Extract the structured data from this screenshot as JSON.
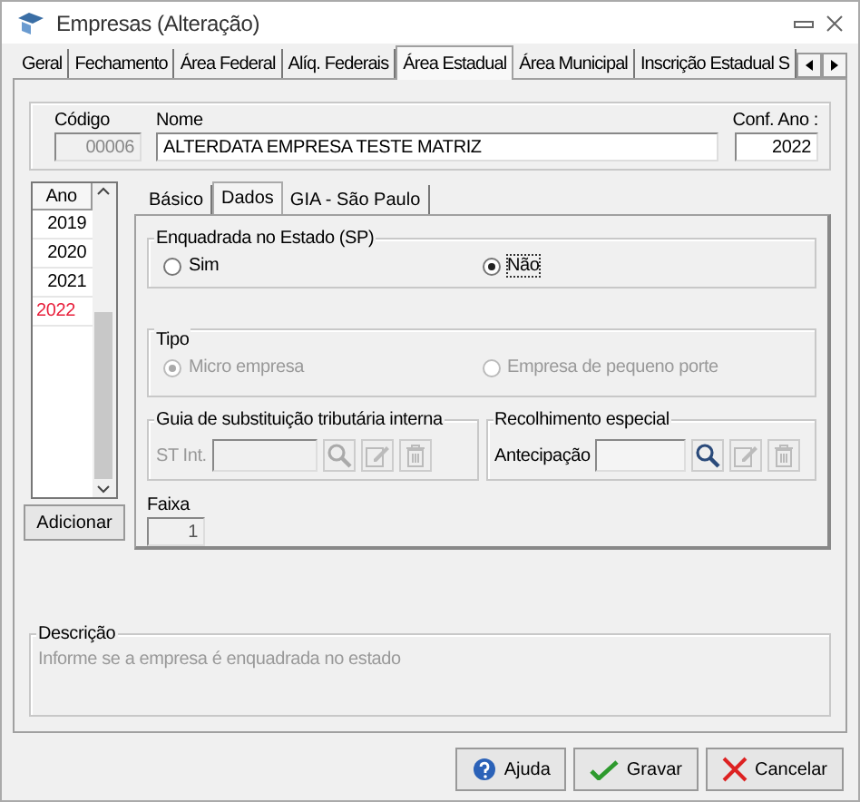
{
  "window": {
    "title": "Empresas (Alteração)"
  },
  "tabs": [
    {
      "label": "Geral",
      "selected": false
    },
    {
      "label": "Fechamento",
      "selected": false
    },
    {
      "label": "Área Federal",
      "selected": false
    },
    {
      "label": "Alíq. Federais",
      "selected": false
    },
    {
      "label": "Área Estadual",
      "selected": true
    },
    {
      "label": "Área Municipal",
      "selected": false
    },
    {
      "label": "Inscrição Estadual S",
      "selected": false
    }
  ],
  "header": {
    "codigo_label": "Código",
    "codigo": "00006",
    "nome_label": "Nome",
    "nome": "ALTERDATA EMPRESA TESTE MATRIZ",
    "ano_label": "Conf. Ano :",
    "ano": "2022"
  },
  "years": {
    "heading": "Ano",
    "items": [
      {
        "label": "2019",
        "selected": false
      },
      {
        "label": "2020",
        "selected": false
      },
      {
        "label": "2021",
        "selected": false
      },
      {
        "label": "2022",
        "selected": true
      }
    ],
    "add_button": "Adicionar"
  },
  "subtabs": [
    {
      "label": "Básico",
      "selected": false
    },
    {
      "label": "Dados",
      "selected": true
    },
    {
      "label": "GIA - São Paulo",
      "selected": false
    }
  ],
  "enquadrada": {
    "title": "Enquadrada no Estado (SP)",
    "disabled": false,
    "options": [
      {
        "label": "Sim",
        "selected": false
      },
      {
        "label": "Não",
        "selected": true
      }
    ]
  },
  "tipo": {
    "title": "Tipo",
    "disabled": true,
    "options": [
      {
        "label": "Micro empresa",
        "selected": true
      },
      {
        "label": "Empresa de pequeno porte",
        "selected": false
      }
    ]
  },
  "guia": {
    "title": "Guia de substituição tributária interna",
    "field_label": "ST Int.",
    "disabled": true
  },
  "recolhimento": {
    "title": "Recolhimento especial",
    "field_label": "Antecipação",
    "disabled": false
  },
  "faixa": {
    "label": "Faixa",
    "value": "1"
  },
  "descricao": {
    "title": "Descrição",
    "text": "Informe se a empresa é enquadrada no estado"
  },
  "buttons": [
    {
      "label": "Ajuda",
      "kind": "help"
    },
    {
      "label": "Gravar",
      "kind": "save"
    },
    {
      "label": "Cancelar",
      "kind": "cancel"
    }
  ]
}
